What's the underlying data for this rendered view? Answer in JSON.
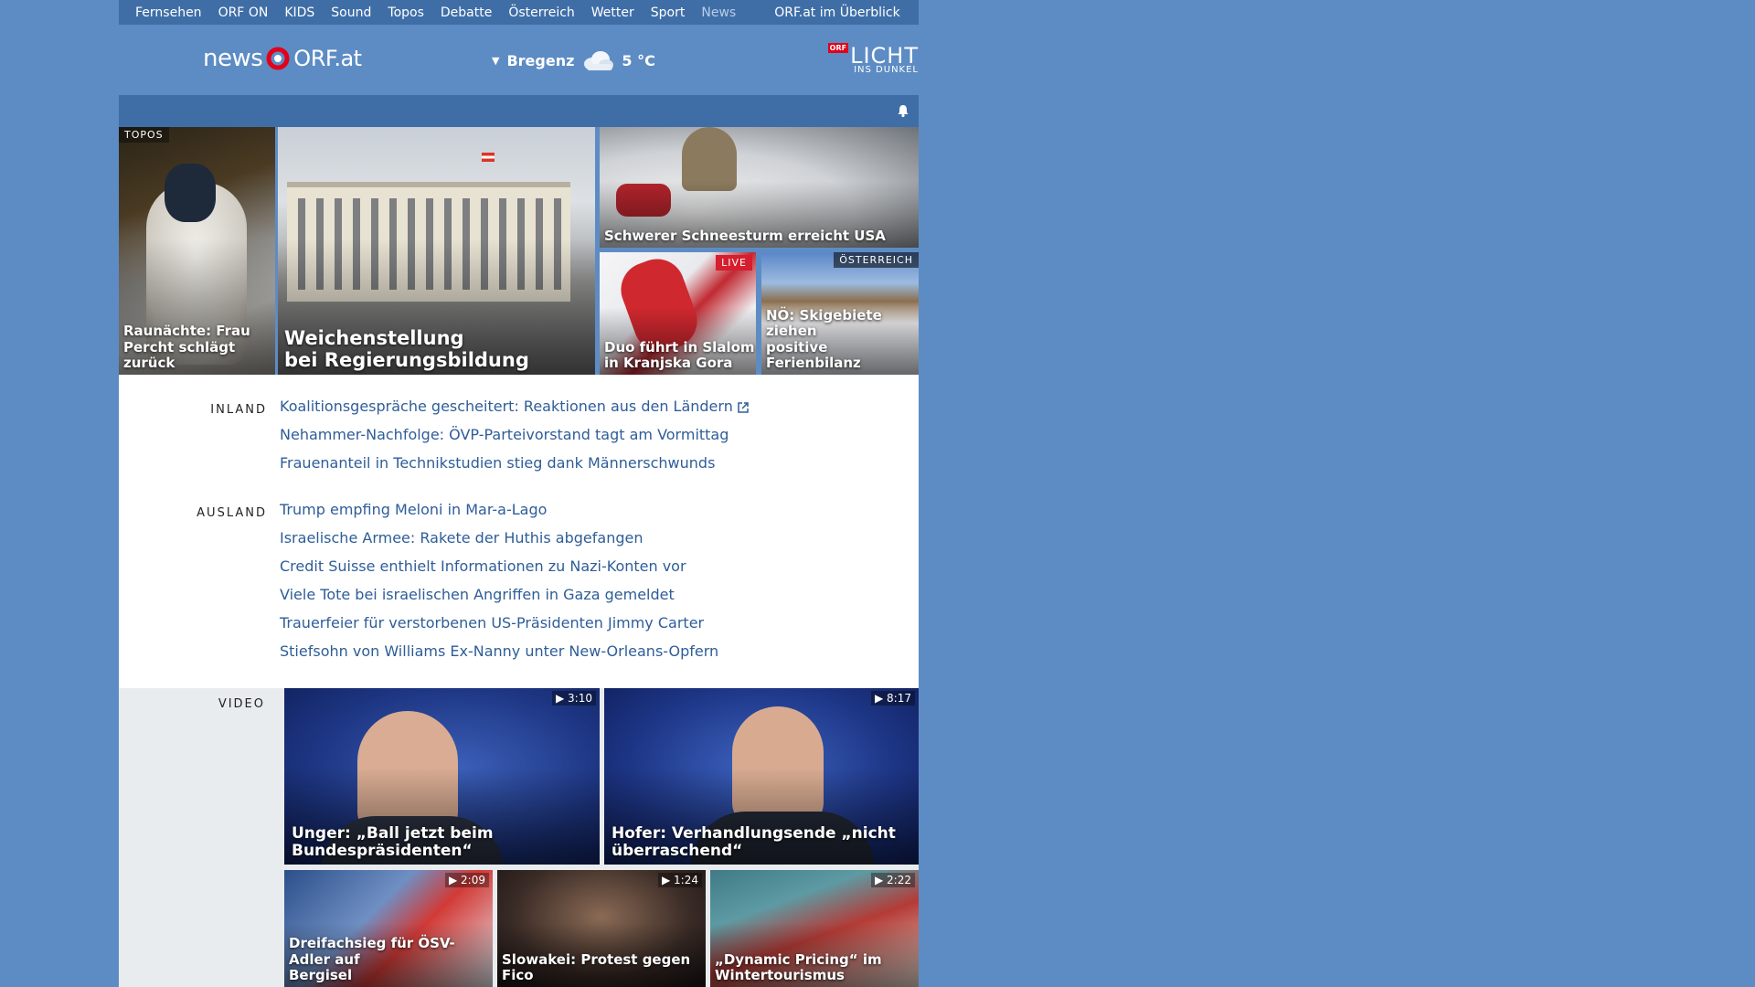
{
  "topnav": [
    {
      "label": "Fernsehen",
      "dim": false
    },
    {
      "label": "ORF ON",
      "dim": false
    },
    {
      "label": "KIDS",
      "dim": false
    },
    {
      "label": "Sound",
      "dim": false
    },
    {
      "label": "Topos",
      "dim": false
    },
    {
      "label": "Debatte",
      "dim": false
    },
    {
      "label": "Österreich",
      "dim": false
    },
    {
      "label": "Wetter",
      "dim": false
    },
    {
      "label": "Sport",
      "dim": false
    },
    {
      "label": "News",
      "dim": true
    }
  ],
  "topnav_overview": "ORF.at im Überblick",
  "logo": {
    "word": "news",
    "orf": "ORF.at"
  },
  "weather": {
    "city": "Bregenz",
    "temp": "5 °C",
    "icon": "cloud-icon"
  },
  "licht": {
    "tag": "ORF",
    "big": "LICHT",
    "small": "INS DUNKEL"
  },
  "tiles": {
    "topos": {
      "badge": "TOPOS",
      "caption": "Raunächte: Frau Percht schlägt zurück"
    },
    "main": {
      "caption_line1": "Weichenstellung",
      "caption_line2": "bei Regierungsbildung"
    },
    "snow": {
      "caption": "Schwerer Schneesturm erreicht USA"
    },
    "slalom": {
      "badge": "LIVE",
      "caption_line1": "Duo führt in Slalom",
      "caption_line2": "in Kranjska Gora"
    },
    "ski": {
      "badge": "ÖSTERREICH",
      "caption_line1": "NÖ: Skigebiete ziehen",
      "caption_line2": "positive Ferienbilanz"
    }
  },
  "inland": {
    "label": "INLAND",
    "links": [
      "Koalitionsgespräche gescheitert: Reaktionen aus den Ländern",
      "Nehammer-Nachfolge: ÖVP-Parteivorstand tagt am Vormittag",
      "Frauenanteil in Technikstudien stieg dank Männerschwunds"
    ]
  },
  "ausland": {
    "label": "AUSLAND",
    "links": [
      "Trump empfing Meloni in Mar-a-Lago",
      "Israelische Armee: Rakete der Huthis abgefangen",
      "Credit Suisse enthielt Informationen zu Nazi-Konten vor",
      "Viele Tote bei israelischen Angriffen in Gaza gemeldet",
      "Trauerfeier für verstorbenen US-Präsidenten Jimmy Carter",
      "Stiefsohn von Williams Ex-Nanny unter New-Orleans-Opfern"
    ]
  },
  "video": {
    "label": "VIDEO",
    "items": [
      {
        "duration": "3:10",
        "line1": "Unger: „Ball jetzt beim",
        "line2": "Bundespräsidenten“"
      },
      {
        "duration": "8:17",
        "line1": "Hofer: Verhandlungsende „nicht",
        "line2": "überraschend“"
      },
      {
        "duration": "2:09",
        "line1": "Dreifachsieg für ÖSV-Adler auf",
        "line2": "Bergisel"
      },
      {
        "duration": "1:24",
        "line1": "Slowakei: Protest gegen Fico",
        "line2": ""
      },
      {
        "duration": "2:22",
        "line1": "„Dynamic Pricing“ im",
        "line2": "Wintertourismus"
      }
    ]
  },
  "colors": {
    "page_bg": "#5d8cc4",
    "nav_bg": "#3f6ea7",
    "link": "#2e5d98",
    "live": "#d51e2e",
    "logo_red": "#e2001a"
  }
}
